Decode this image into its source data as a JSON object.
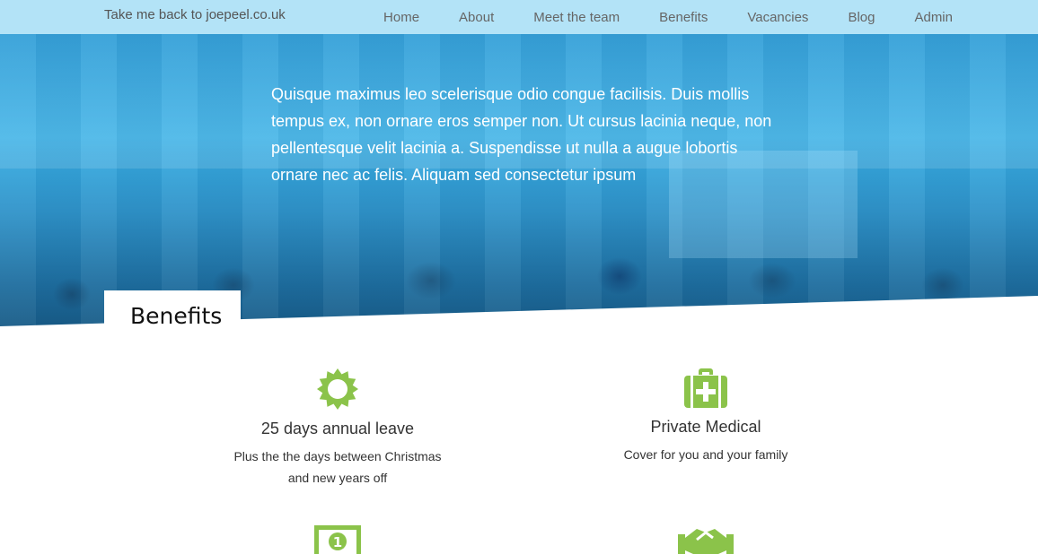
{
  "topbar": {
    "back_link": "Take me back to joepeel.co.uk",
    "nav": [
      "Home",
      "About",
      "Meet the team",
      "Benefits",
      "Vacancies",
      "Blog",
      "Admin"
    ]
  },
  "hero": {
    "text": "Quisque maximus leo scelerisque odio congue facilisis. Duis mollis tempus ex, non ornare eros semper non. Ut cursus lacinia neque, non pellentesque velit lacinia a. Suspendisse ut nulla a augue lobortis ornare nec ac felis. Aliquam sed consectetur ipsum"
  },
  "benefits": {
    "heading": "Benefits",
    "items": [
      {
        "icon": "sun-icon",
        "title": "25 days annual leave",
        "desc_line1": "Plus the the days between Christmas",
        "desc_line2": "and new years off"
      },
      {
        "icon": "medical-kit-icon",
        "title": "Private Medical",
        "desc_line1": "Cover for you and your family",
        "desc_line2": ""
      },
      {
        "icon": "money-icon",
        "title": "",
        "desc_line1": "",
        "desc_line2": ""
      },
      {
        "icon": "handshake-icon",
        "title": "",
        "desc_line1": "",
        "desc_line2": ""
      }
    ]
  },
  "colors": {
    "topbar": "#b3e3f7",
    "hero_blue": "#2a9bd6",
    "icon_green": "#8bc34a"
  }
}
